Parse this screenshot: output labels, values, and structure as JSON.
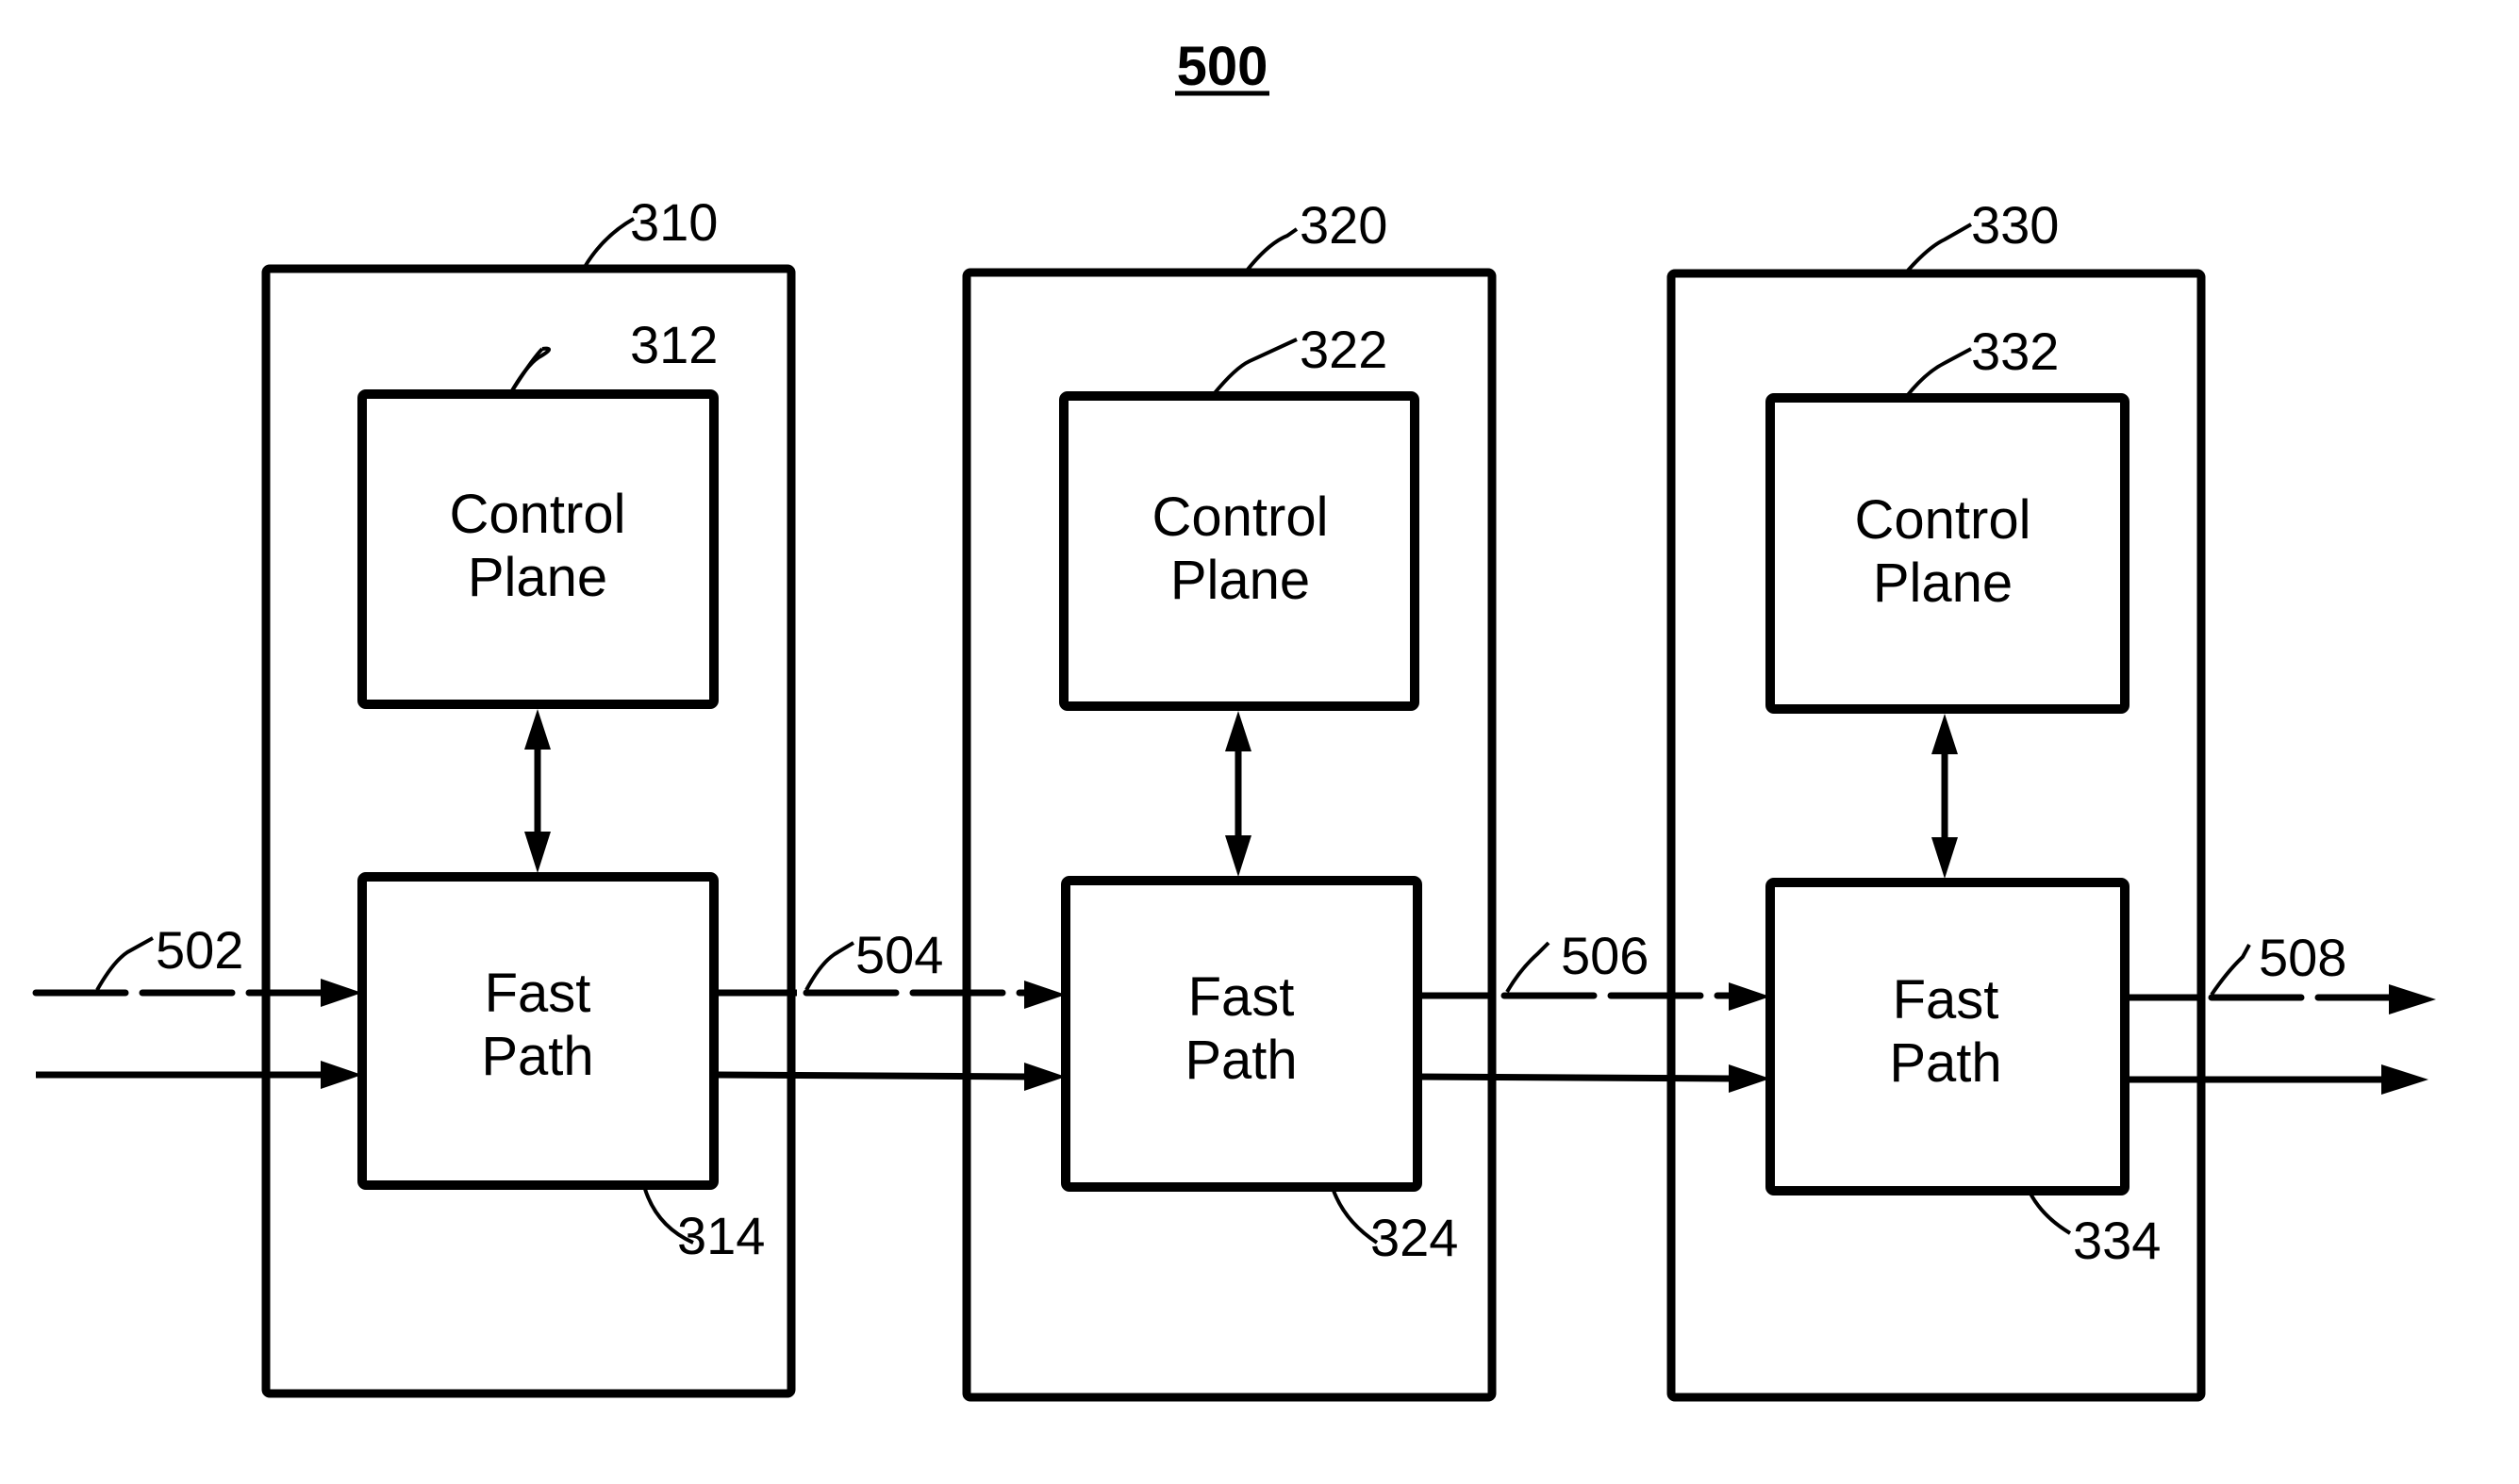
{
  "figure": {
    "number": "500",
    "colors": {
      "ink": "#000000",
      "background": "#ffffff"
    }
  },
  "nodes": [
    {
      "ref": "310",
      "control_plane": {
        "ref": "312",
        "label_line1": "Control",
        "label_line2": "Plane"
      },
      "fast_path": {
        "ref": "314",
        "label_line1": "Fast",
        "label_line2": "Path"
      }
    },
    {
      "ref": "320",
      "control_plane": {
        "ref": "322",
        "label_line1": "Control",
        "label_line2": "Plane"
      },
      "fast_path": {
        "ref": "324",
        "label_line1": "Fast",
        "label_line2": "Path"
      }
    },
    {
      "ref": "330",
      "control_plane": {
        "ref": "332",
        "label_line1": "Control",
        "label_line2": "Plane"
      },
      "fast_path": {
        "ref": "334",
        "label_line1": "Fast",
        "label_line2": "Path"
      }
    }
  ],
  "links": [
    {
      "ref": "502"
    },
    {
      "ref": "504"
    },
    {
      "ref": "506"
    },
    {
      "ref": "508"
    }
  ]
}
